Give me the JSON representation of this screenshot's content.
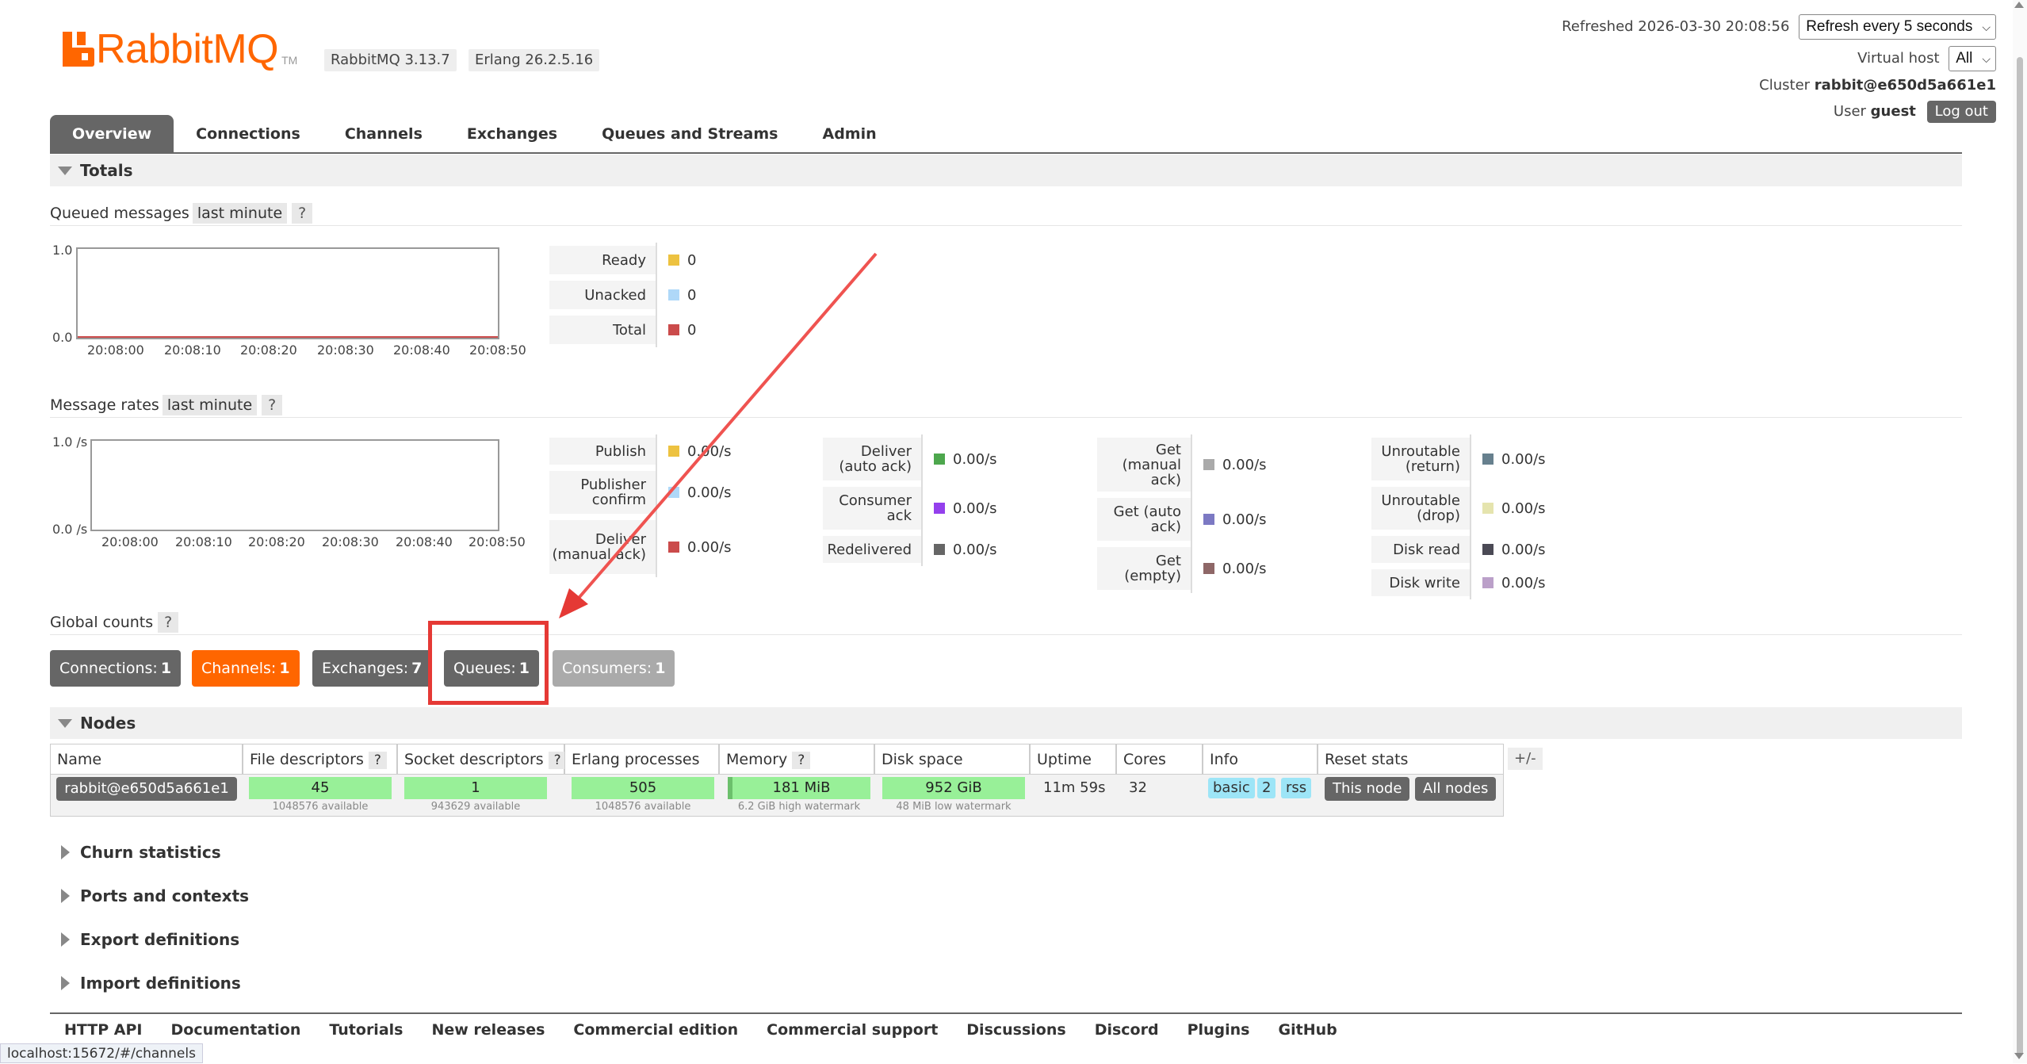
{
  "header": {
    "logo_text": "RabbitMQ",
    "logo_tm": "TM",
    "version": "RabbitMQ 3.13.7",
    "erlang": "Erlang 26.2.5.16",
    "refreshed_label": "Refreshed 2026-03-30 20:08:56",
    "refresh_select": "Refresh every 5 seconds",
    "vhost_label": "Virtual host",
    "vhost_select": "All",
    "cluster_label": "Cluster",
    "cluster_value": "rabbit@e650d5a661e1",
    "user_label": "User",
    "user_value": "guest",
    "logout": "Log out"
  },
  "tabs": [
    "Overview",
    "Connections",
    "Channels",
    "Exchanges",
    "Queues and Streams",
    "Admin"
  ],
  "totals": {
    "title": "Totals",
    "queued": {
      "label": "Queued messages",
      "range": "last minute",
      "help": "?",
      "y_top": "1.0",
      "y_bottom": "0.0",
      "x_ticks": [
        "20:08:00",
        "20:08:10",
        "20:08:20",
        "20:08:30",
        "20:08:40",
        "20:08:50"
      ],
      "legend": [
        {
          "label": "Ready",
          "value": "0",
          "color": "#edc240"
        },
        {
          "label": "Unacked",
          "value": "0",
          "color": "#afd8f8"
        },
        {
          "label": "Total",
          "value": "0",
          "color": "#cb4b4b"
        }
      ]
    },
    "rates": {
      "label": "Message rates",
      "range": "last minute",
      "help": "?",
      "y_top": "1.0 /s",
      "y_bottom": "0.0 /s",
      "x_ticks": [
        "20:08:00",
        "20:08:10",
        "20:08:20",
        "20:08:30",
        "20:08:40",
        "20:08:50"
      ],
      "col1": [
        {
          "label": "Publish",
          "value": "0.00/s",
          "color": "#edc240"
        },
        {
          "label": "Publisher confirm",
          "value": "0.00/s",
          "color": "#afd8f8"
        },
        {
          "label": "Deliver (manual ack)",
          "value": "0.00/s",
          "color": "#cb4b4b"
        }
      ],
      "col2": [
        {
          "label": "Deliver (auto ack)",
          "value": "0.00/s",
          "color": "#4da74d"
        },
        {
          "label": "Consumer ack",
          "value": "0.00/s",
          "color": "#9440ed"
        },
        {
          "label": "Redelivered",
          "value": "0.00/s",
          "color": "#666666"
        }
      ],
      "col3": [
        {
          "label": "Get (manual ack)",
          "value": "0.00/s",
          "color": "#aaaaaa"
        },
        {
          "label": "Get (auto ack)",
          "value": "0.00/s",
          "color": "#7c79c3"
        },
        {
          "label": "Get (empty)",
          "value": "0.00/s",
          "color": "#8e6767"
        }
      ],
      "col4": [
        {
          "label": "Unroutable (return)",
          "value": "0.00/s",
          "color": "#67808e"
        },
        {
          "label": "Unroutable (drop)",
          "value": "0.00/s",
          "color": "#e5e4ae"
        },
        {
          "label": "Disk read",
          "value": "0.00/s",
          "color": "#4b4a55"
        },
        {
          "label": "Disk write",
          "value": "0.00/s",
          "color": "#bba0c9"
        }
      ]
    },
    "global": {
      "label": "Global counts",
      "help": "?",
      "buttons": [
        {
          "label": "Connections:",
          "count": "1",
          "color": "#666666"
        },
        {
          "label": "Channels:",
          "count": "1",
          "color": "#ff6600"
        },
        {
          "label": "Exchanges:",
          "count": "7",
          "color": "#666666"
        },
        {
          "label": "Queues:",
          "count": "1",
          "color": "#666666"
        },
        {
          "label": "Consumers:",
          "count": "1",
          "color": "#aaaaaa"
        }
      ]
    }
  },
  "nodes": {
    "title": "Nodes",
    "headers": [
      "Name",
      "File descriptors",
      "Socket descriptors",
      "Erlang processes",
      "Memory",
      "Disk space",
      "Uptime",
      "Cores",
      "Info",
      "Reset stats"
    ],
    "help": "?",
    "plusminus": "+/-",
    "row": {
      "name": "rabbit@e650d5a661e1",
      "fd": "45",
      "fd_sub": "1048576 available",
      "sd": "1",
      "sd_sub": "943629 available",
      "ep": "505",
      "ep_sub": "1048576 available",
      "mem": "181 MiB",
      "mem_sub": "6.2 GiB high watermark",
      "disk": "952 GiB",
      "disk_sub": "48 MiB low watermark",
      "uptime": "11m 59s",
      "cores": "32",
      "info": [
        "basic",
        "2",
        "rss"
      ],
      "reset": [
        "This node",
        "All nodes"
      ]
    }
  },
  "collapsed": [
    "Churn statistics",
    "Ports and contexts",
    "Export definitions",
    "Import definitions"
  ],
  "footer": [
    "HTTP API",
    "Documentation",
    "Tutorials",
    "New releases",
    "Commercial edition",
    "Commercial support",
    "Discussions",
    "Discord",
    "Plugins",
    "GitHub"
  ],
  "status_url": "localhost:15672/#/channels"
}
